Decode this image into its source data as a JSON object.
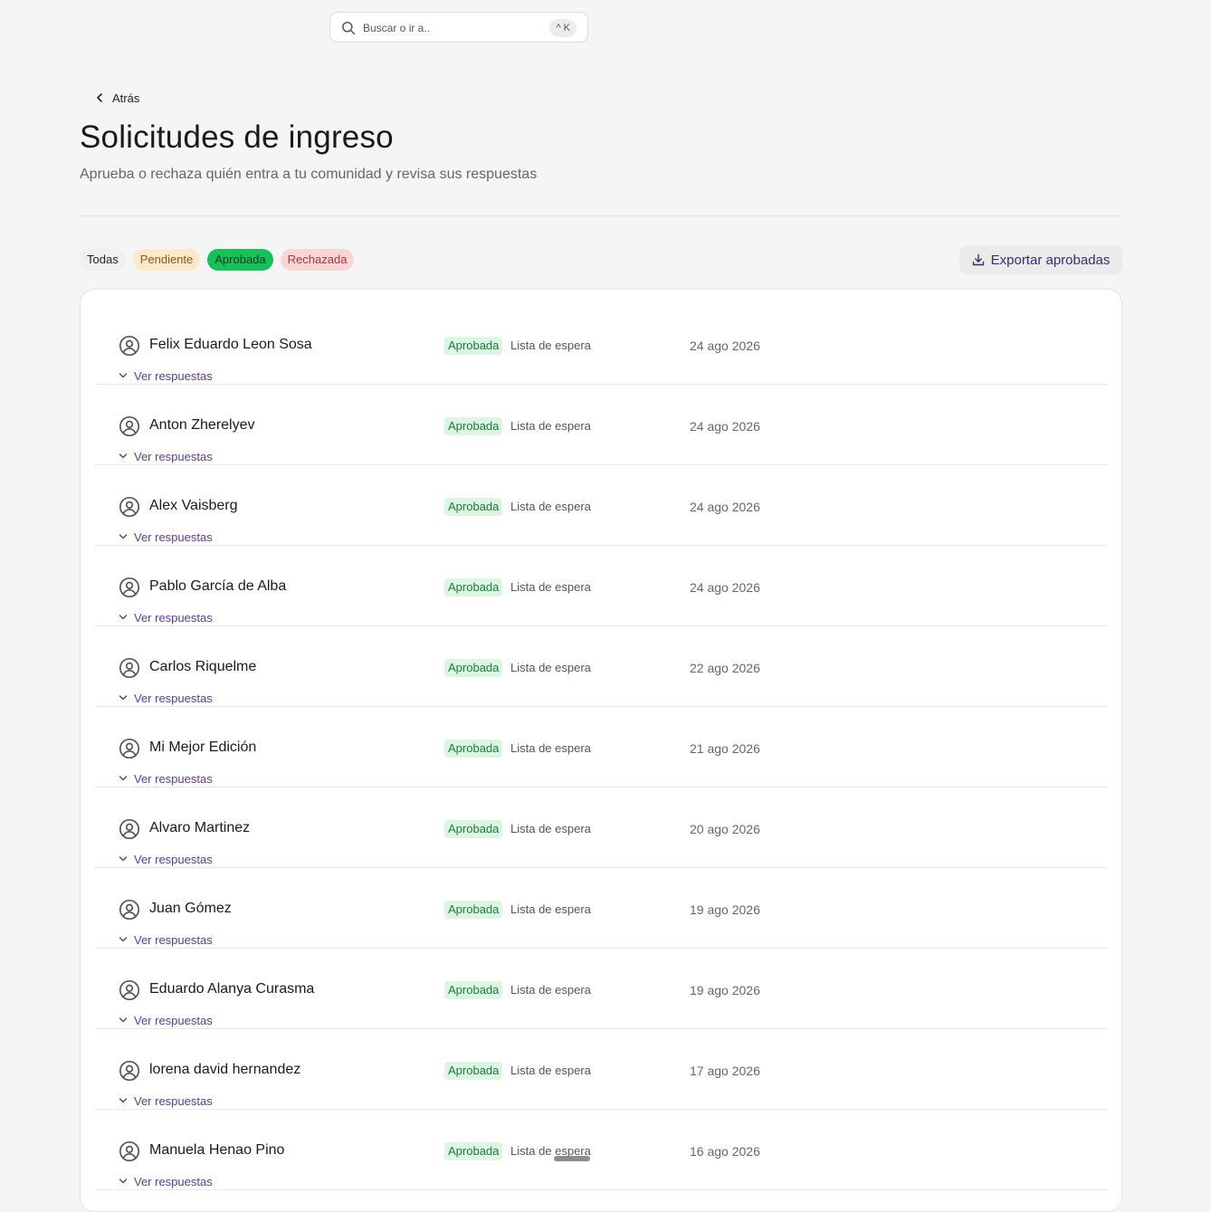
{
  "search": {
    "placeholder": "Buscar o ir a..",
    "shortcut": "^ K"
  },
  "nav": {
    "back_label": "Atrás"
  },
  "header": {
    "title": "Solicitudes de ingreso",
    "subtitle": "Aprueba o rechaza quién entra a tu comunidad y revisa sus respuestas"
  },
  "filters": {
    "all": "Todas",
    "pending": "Pendiente",
    "approved": "Aprobada",
    "rejected": "Rechazada",
    "selected": "approved"
  },
  "actions": {
    "export_label": "Exportar aprobadas"
  },
  "colors": {
    "approved_chip": "#16c05a",
    "approved_badge_bg": "#ddf5e3",
    "accent_link": "#5b3d8e"
  },
  "requests": [
    {
      "name": "Felix Eduardo Leon Sosa",
      "status": "Aprobada",
      "list": "Lista de espera",
      "date": "24 ago 2026",
      "toggle": "Ver respuestas"
    },
    {
      "name": "Anton Zherelyev",
      "status": "Aprobada",
      "list": "Lista de espera",
      "date": "24 ago 2026",
      "toggle": "Ver respuestas"
    },
    {
      "name": "Alex Vaisberg",
      "status": "Aprobada",
      "list": "Lista de espera",
      "date": "24 ago 2026",
      "toggle": "Ver respuestas"
    },
    {
      "name": "Pablo García de Alba",
      "status": "Aprobada",
      "list": "Lista de espera",
      "date": "24 ago 2026",
      "toggle": "Ver respuestas"
    },
    {
      "name": "Carlos Riquelme",
      "status": "Aprobada",
      "list": "Lista de espera",
      "date": "22 ago 2026",
      "toggle": "Ver respuestas"
    },
    {
      "name": "Mi Mejor Edición",
      "status": "Aprobada",
      "list": "Lista de espera",
      "date": "21 ago 2026",
      "toggle": "Ver respuestas"
    },
    {
      "name": "Alvaro Martinez",
      "status": "Aprobada",
      "list": "Lista de espera",
      "date": "20 ago 2026",
      "toggle": "Ver respuestas"
    },
    {
      "name": "Juan Gómez",
      "status": "Aprobada",
      "list": "Lista de espera",
      "date": "19 ago 2026",
      "toggle": "Ver respuestas"
    },
    {
      "name": "Eduardo Alanya Curasma",
      "status": "Aprobada",
      "list": "Lista de espera",
      "date": "19 ago 2026",
      "toggle": "Ver respuestas"
    },
    {
      "name": "lorena david hernandez",
      "status": "Aprobada",
      "list": "Lista de espera",
      "date": "17 ago 2026",
      "toggle": "Ver respuestas"
    },
    {
      "name": "Manuela Henao Pino",
      "status": "Aprobada",
      "list": "Lista de espera",
      "date": "16 ago 2026",
      "toggle": "Ver respuestas"
    }
  ]
}
